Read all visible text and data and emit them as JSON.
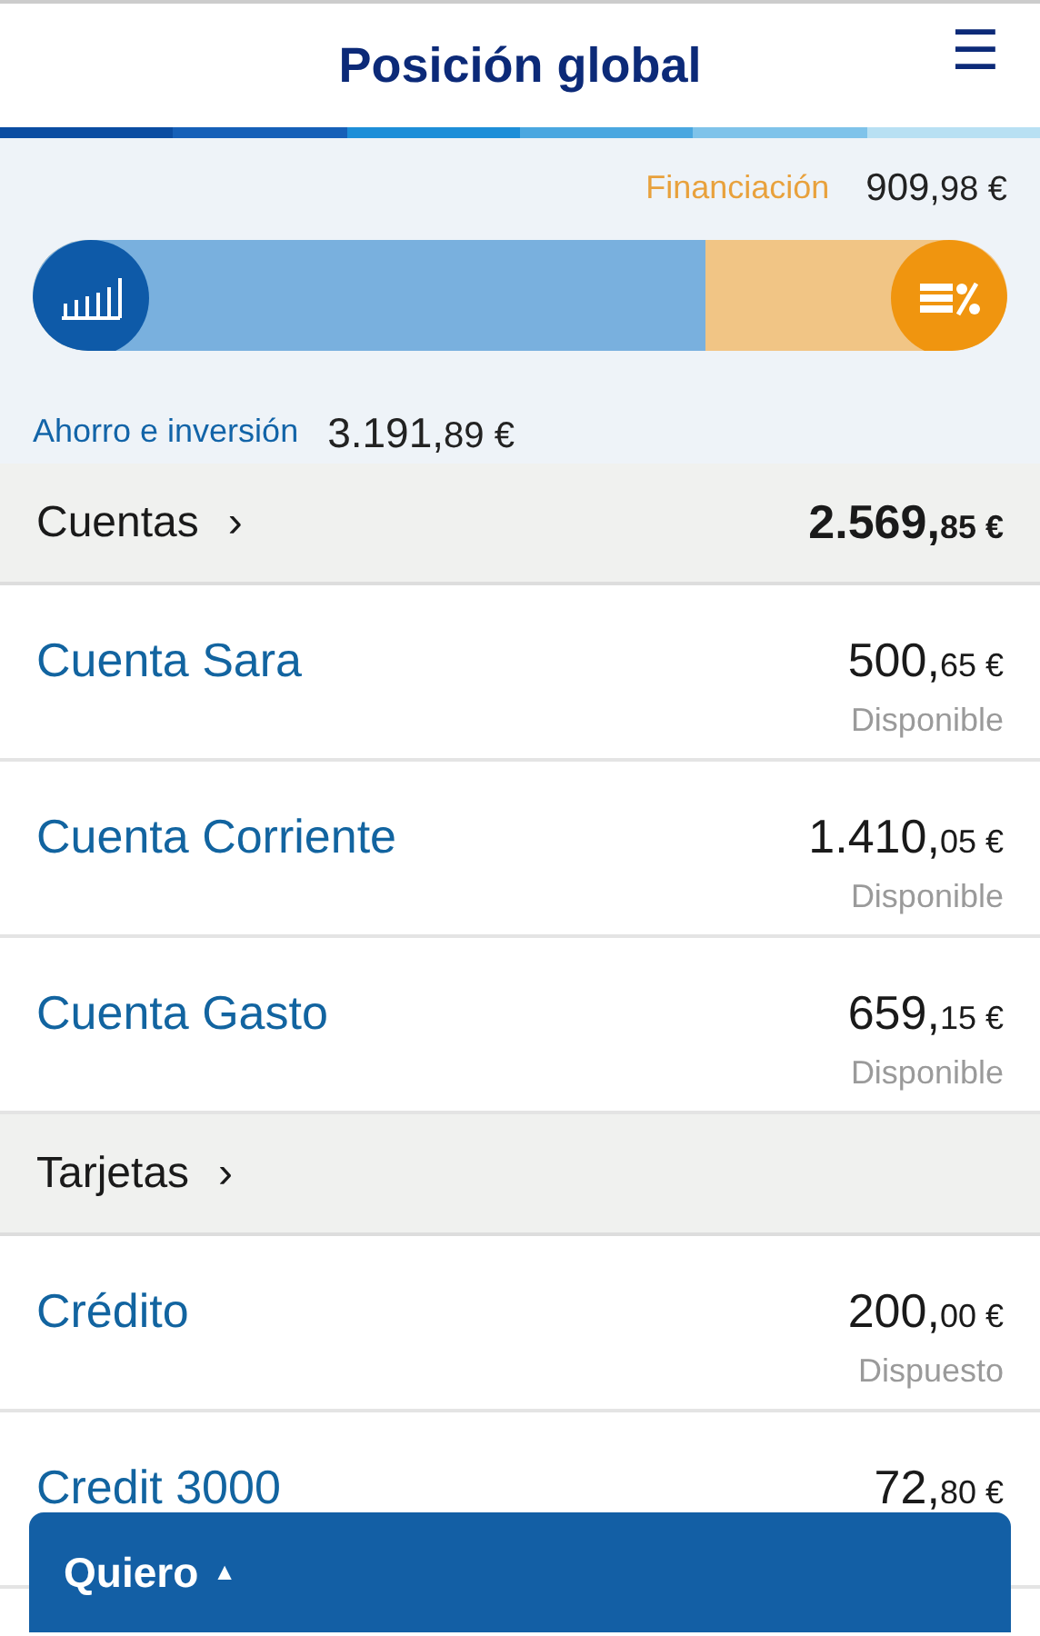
{
  "header": {
    "title": "Posición global",
    "menu_glyph": "☰"
  },
  "summary": {
    "financing": {
      "label": "Financiación",
      "main": "909,",
      "minor": "98 €"
    },
    "savings": {
      "label": "Ahorro e inversión",
      "main": "3.191,",
      "minor": "89 €"
    },
    "level": 0.69
  },
  "sections": [
    {
      "title": "Cuentas",
      "chevron": "›",
      "total": {
        "main": "2.569,",
        "minor": "85 €"
      },
      "rows": [
        {
          "name": "Cuenta Sara",
          "main": "500,",
          "minor": "65 €",
          "note": "Disponible"
        },
        {
          "name": "Cuenta Corriente",
          "main": "1.410,",
          "minor": "05 €",
          "note": "Disponible"
        },
        {
          "name": "Cuenta Gasto",
          "main": "659,",
          "minor": "15 €",
          "note": "Disponible"
        }
      ]
    },
    {
      "title": "Tarjetas",
      "chevron": "›",
      "rows": [
        {
          "name": "Crédito",
          "main": "200,",
          "minor": "00 €",
          "note": "Dispuesto"
        },
        {
          "name": "Credit 3000",
          "main": "72,",
          "minor": "80 €"
        }
      ]
    }
  ],
  "action_bar": {
    "label": "Quiero",
    "caret": "▲"
  }
}
